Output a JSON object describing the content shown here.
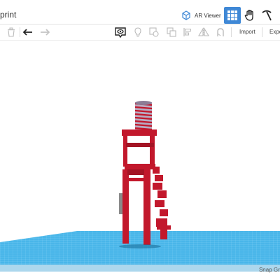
{
  "header": {
    "title_fragment": "print",
    "ar_viewer_label": "AR Viewer",
    "icons": [
      "cube-ar-icon",
      "grid-icon",
      "hand-icon",
      "pickaxe-icon"
    ]
  },
  "toolbar": {
    "import_label": "Import",
    "export_label": "Expo",
    "icons": [
      "trash-icon",
      "undo-icon",
      "redo-icon",
      "view-icon",
      "light-bulb-icon",
      "shape-icon",
      "group-icon",
      "align-icon",
      "mirror-icon",
      "magnet-icon"
    ]
  },
  "footer": {
    "snap_grid_label": "Snap Grid"
  },
  "colors": {
    "accent": "#3f88d6",
    "model_red": "#c2182c",
    "workplane_blue": "#49b6e9"
  }
}
